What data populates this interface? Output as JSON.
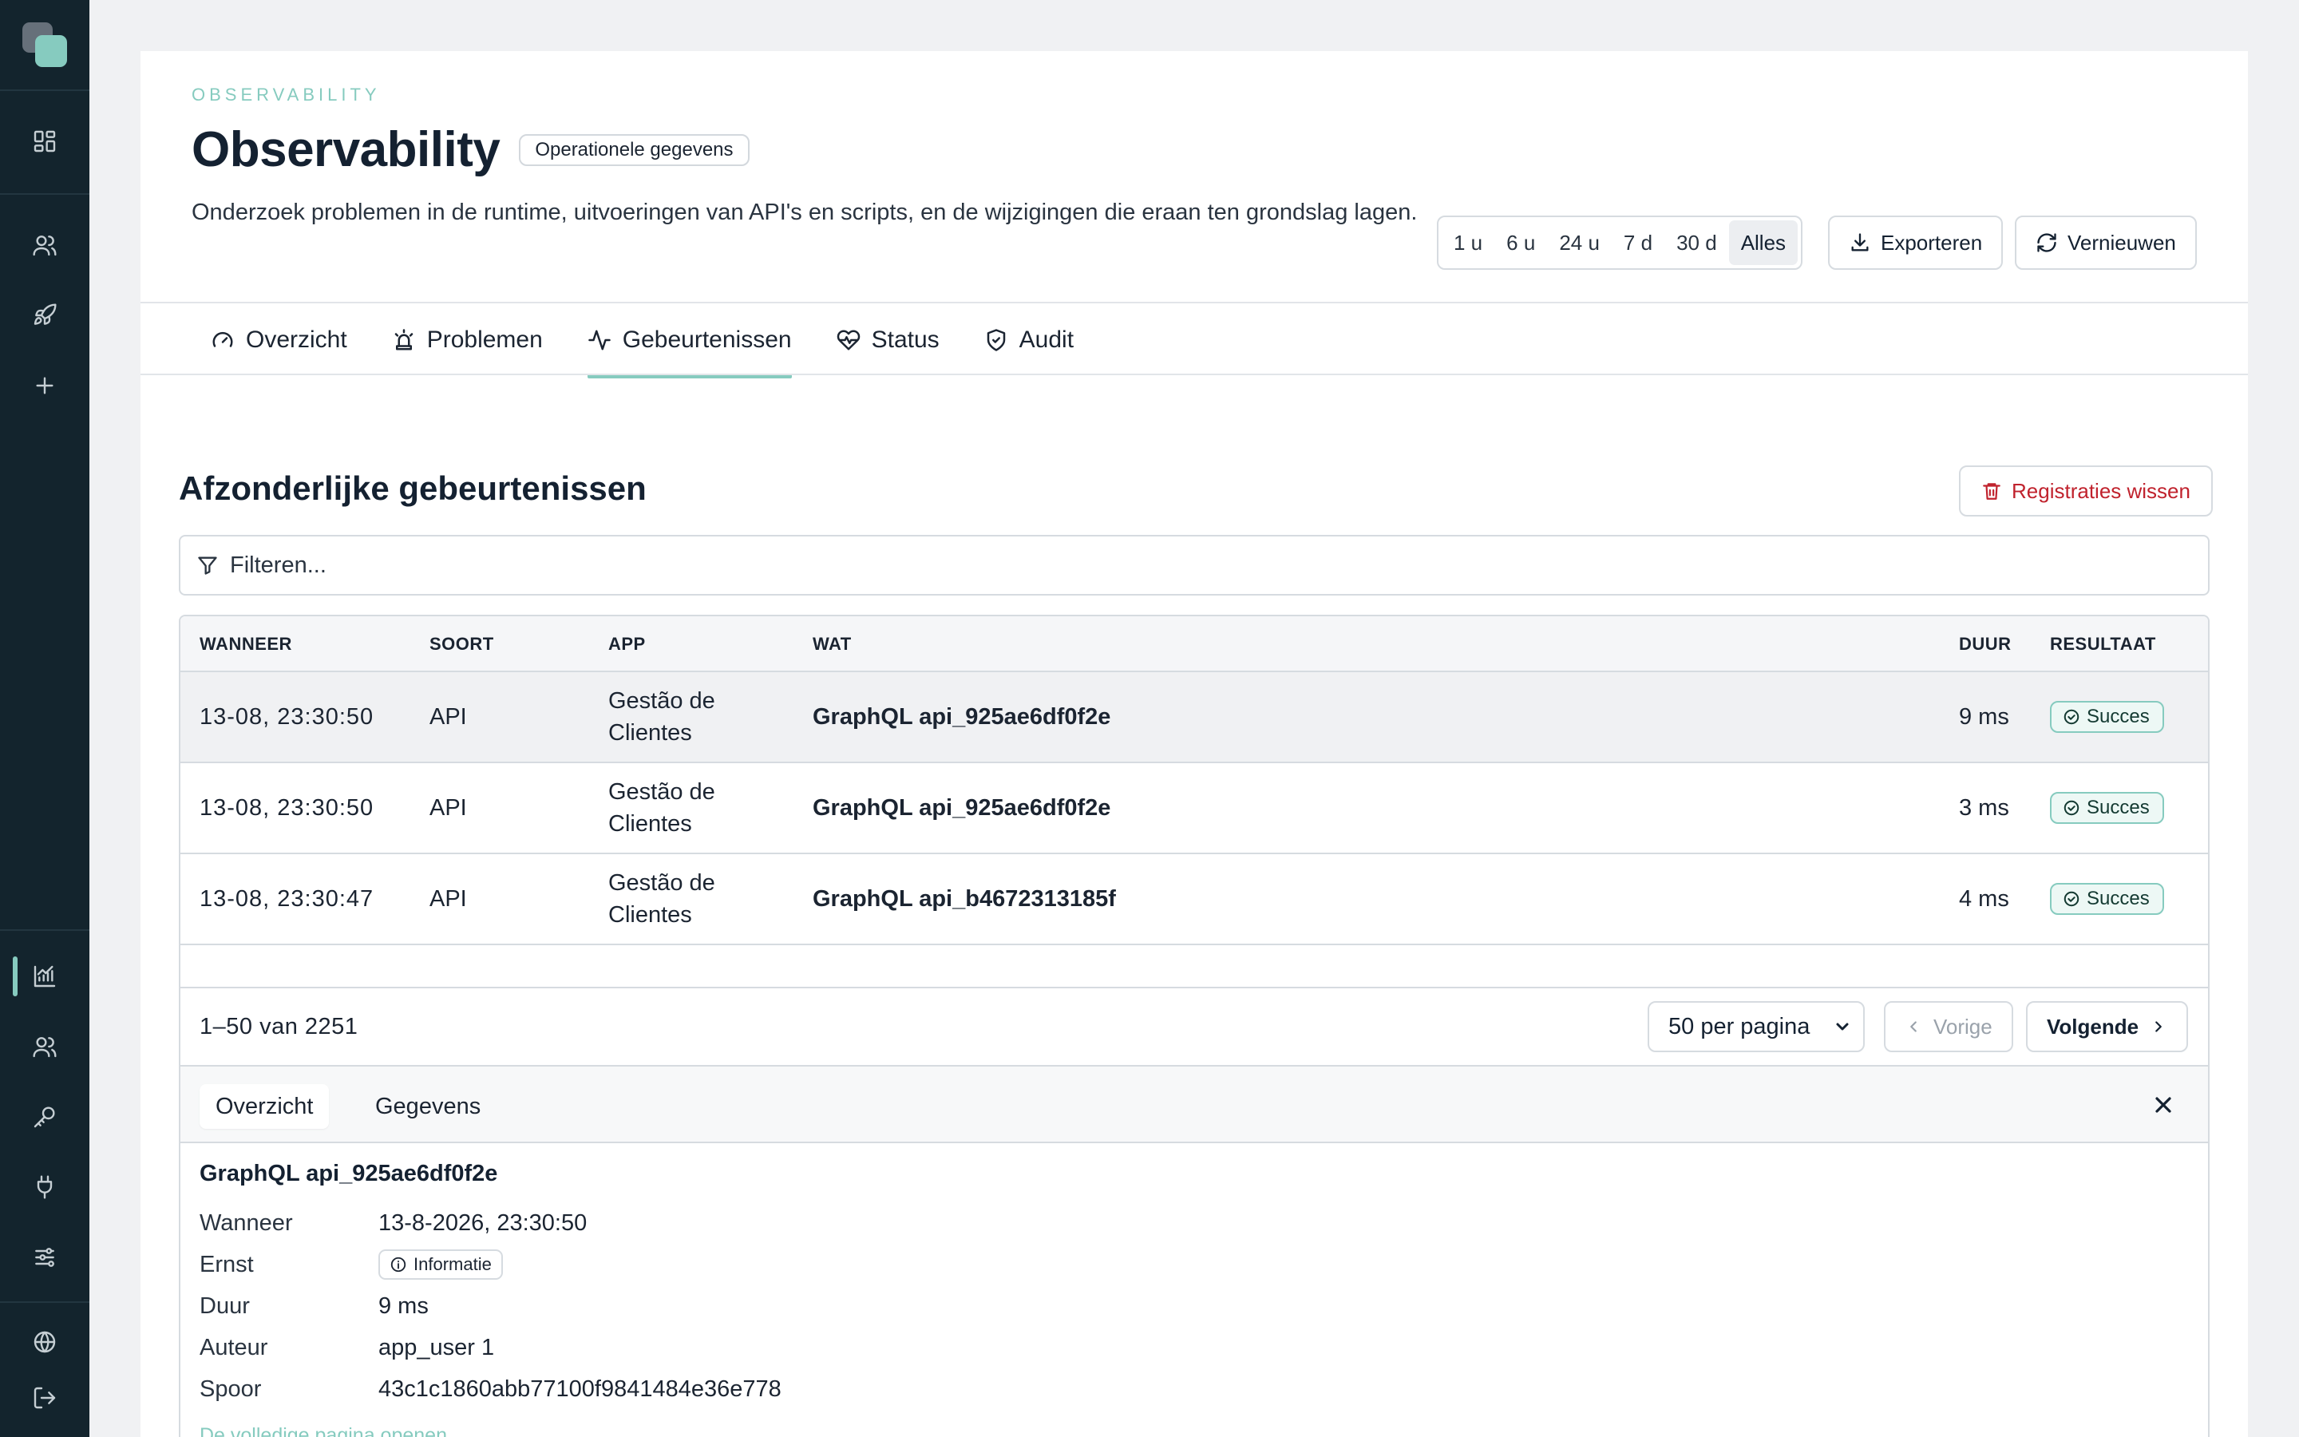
{
  "sidebar": {
    "icons": [
      "logo",
      "dashboard-icon",
      "users-icon",
      "rocket-icon",
      "plus-icon",
      "analytics-icon",
      "team-icon",
      "key-icon",
      "plug-icon",
      "sliders-icon",
      "globe-icon",
      "logout-icon"
    ],
    "active": "analytics-icon",
    "accent": "#86cbbf"
  },
  "header": {
    "eyebrow": "OBSERVABILITY",
    "title": "Observability",
    "badge": "Operationele gegevens",
    "description": "Onderzoek problemen in de runtime, uitvoeringen van API's en scripts, en de wijzigingen die eraan ten grondslag lagen."
  },
  "range": {
    "options": [
      "1 u",
      "6 u",
      "24 u",
      "7 d",
      "30 d",
      "Alles"
    ],
    "selected": "Alles"
  },
  "actions": {
    "export_label": "Exporteren",
    "refresh_label": "Vernieuwen"
  },
  "tabs": [
    {
      "label": "Overzicht",
      "icon": "gauge-icon"
    },
    {
      "label": "Problemen",
      "icon": "siren-icon"
    },
    {
      "label": "Gebeurtenissen",
      "icon": "activity-icon"
    },
    {
      "label": "Status",
      "icon": "heart-pulse-icon"
    },
    {
      "label": "Audit",
      "icon": "shield-check-icon"
    }
  ],
  "active_tab": "Gebeurtenissen",
  "events": {
    "title": "Afzonderlijke gebeurtenissen",
    "clear_label": "Registraties wissen",
    "filter_placeholder": "Filteren...",
    "columns": {
      "when": "WANNEER",
      "kind": "SOORT",
      "app": "APP",
      "what": "WAT",
      "duration": "DUUR",
      "result": "RESULTAAT"
    },
    "rows": [
      {
        "when": "13-08, 23:30:50",
        "kind": "API",
        "app": "Gestão de Clientes",
        "what": "GraphQL api_925ae6df0f2e",
        "duration": "9 ms",
        "result": "Succes"
      },
      {
        "when": "13-08, 23:30:50",
        "kind": "API",
        "app": "Gestão de Clientes",
        "what": "GraphQL api_925ae6df0f2e",
        "duration": "3 ms",
        "result": "Succes"
      },
      {
        "when": "13-08, 23:30:47",
        "kind": "API",
        "app": "Gestão de Clientes",
        "what": "GraphQL api_b4672313185f",
        "duration": "4 ms",
        "result": "Succes"
      }
    ],
    "pager": {
      "count": "1–50 van 2251",
      "per_page": "50 per pagina",
      "prev_label": "Vorige",
      "next_label": "Volgende"
    }
  },
  "detail": {
    "tabs": [
      "Overzicht",
      "Gegevens"
    ],
    "active_tab": "Overzicht",
    "title": "GraphQL api_925ae6df0f2e",
    "fields": {
      "when_label": "Wanneer",
      "when_value": "13-8-2026, 23:30:50",
      "severity_label": "Ernst",
      "severity_value": "Informatie",
      "duration_label": "Duur",
      "duration_value": "9 ms",
      "author_label": "Auteur",
      "author_value": "app_user 1",
      "trace_label": "Spoor",
      "trace_value": "43c1c1860abb77100f9841484e36e778"
    },
    "open_link": "De volledige pagina openen"
  }
}
